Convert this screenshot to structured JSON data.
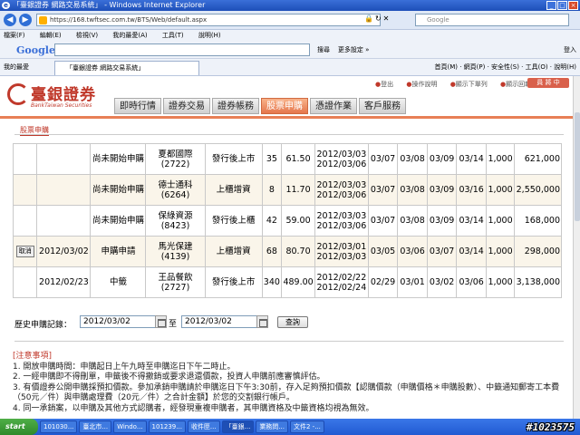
{
  "window": {
    "title": "「臺銀證券 網路交易系統」 - Windows Internet Explorer"
  },
  "address": {
    "url": "https://168.twftsec.com.tw/BTS/Web/default.aspx",
    "search_placeholder": "Google"
  },
  "menu": [
    "檔案(F)",
    "編輯(E)",
    "檢視(V)",
    "我的最愛(A)",
    "工具(T)",
    "說明(H)"
  ],
  "google_bar": {
    "logo": "Google",
    "search_label": "搜尋",
    "more_label": "更多設定 »",
    "login_label": "登入"
  },
  "favorites": {
    "label": "我的最愛",
    "tab_title": "「臺銀證券 網路交易系統」",
    "tools": "首頁(M) · 網頁(P) · 安全性(S) · 工具(O) · 說明(H)"
  },
  "site": {
    "logo_cn": "臺銀證券",
    "logo_en": "BankTaiwan Securities",
    "top_links": [
      "登出",
      "操作說明",
      "顯示下單列",
      "顯示回報"
    ],
    "employee_label": "員 將 中",
    "nav": [
      "即時行情",
      "證券交易",
      "證券帳務",
      "股票申購",
      "憑證作業",
      "客戶服務"
    ],
    "active_nav": "股票申購",
    "sub_title": "股票申購"
  },
  "table": {
    "rows": [
      {
        "action": "",
        "date": "",
        "status": "尚未開始申購",
        "name": "夏都國際",
        "code": "(2722)",
        "type": "發行後上市",
        "lots": "35",
        "price": "61.50",
        "period_start": "2012/03/03",
        "period_end": "2012/03/06",
        "d1": "03/07",
        "d2": "03/08",
        "d3": "03/09",
        "d4": "03/14",
        "units": "1,000",
        "amount": "621,000"
      },
      {
        "action": "",
        "date": "",
        "status": "尚未開始申購",
        "name": "德士通科",
        "code": "(6264)",
        "type": "上櫃增資",
        "lots": "8",
        "price": "11.70",
        "period_start": "2012/03/03",
        "period_end": "2012/03/06",
        "d1": "03/07",
        "d2": "03/08",
        "d3": "03/09",
        "d4": "03/16",
        "units": "1,000",
        "amount": "2,550,000"
      },
      {
        "action": "",
        "date": "",
        "status": "尚未開始申購",
        "name": "保綠資源",
        "code": "(8423)",
        "type": "發行後上櫃",
        "lots": "42",
        "price": "59.00",
        "period_start": "2012/03/03",
        "period_end": "2012/03/06",
        "d1": "03/07",
        "d2": "03/08",
        "d3": "03/09",
        "d4": "03/14",
        "units": "1,000",
        "amount": "168,000"
      },
      {
        "action": "取消",
        "date": "2012/03/02",
        "status": "申購申請",
        "name": "馬光保建",
        "code": "(4139)",
        "type": "上櫃增資",
        "lots": "68",
        "price": "80.70",
        "period_start": "2012/03/01",
        "period_end": "2012/03/03",
        "d1": "03/05",
        "d2": "03/06",
        "d3": "03/07",
        "d4": "03/14",
        "units": "1,000",
        "amount": "298,000"
      },
      {
        "action": "",
        "date": "2012/02/23",
        "status": "中籤",
        "name": "王品餐飲",
        "code": "(2727)",
        "type": "發行後上市",
        "lots": "340",
        "price": "489.00",
        "period_start": "2012/02/22",
        "period_end": "2012/02/24",
        "d1": "02/29",
        "d2": "03/01",
        "d3": "03/02",
        "d4": "03/06",
        "units": "1,000",
        "amount": "3,138,000"
      }
    ]
  },
  "history": {
    "label": "歷史申購記錄：",
    "from": "2012/03/02",
    "to_sep": "至",
    "to": "2012/03/02",
    "query_button": "查詢"
  },
  "notes": {
    "title": "[注意事項]",
    "items": [
      "1. 開放申購時間：申購起日上午九時至申購迄日下午二時止。",
      "2. 一經申購即不得刪單，申籤後不得撤銷或要求退還價款，投資人申購前應審慎評估。",
      "3. 有價證券公開申購採預扣價款。參加承銷申購請於申購迄日下午3:30前，存入足夠預扣價款【認購價款（申購價格＊申購股數）、中籤通知郵寄工本費（50元／件）與申購處理費（20元／件）之合計金額】於您的交割銀行帳戶。",
      "4. 同一承銷案，以申購及其他方式認購者，經發現重複申購者，其申購資格及中籤資格均視為無效。"
    ]
  },
  "taskbar": {
    "start": "start",
    "buttons": [
      "101030...",
      "臺北市...",
      "Windo...",
      "101239...",
      "收件匣...",
      "「臺銀...",
      "業務問...",
      "文件2 -..."
    ],
    "watermark": "#1023575"
  }
}
